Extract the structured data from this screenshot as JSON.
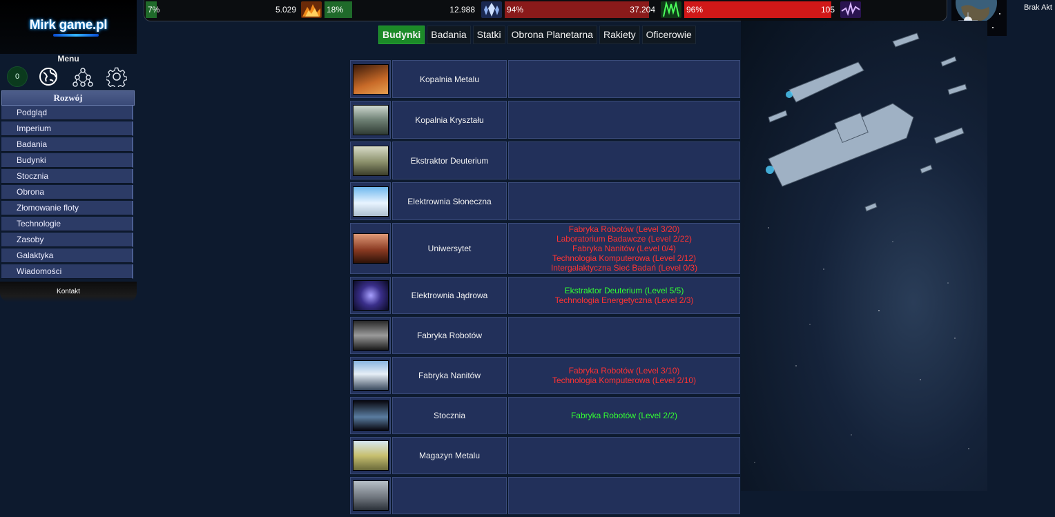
{
  "logo": {
    "text": "Mirk game.pl"
  },
  "menu": {
    "title": "Menu",
    "message_count": "0"
  },
  "menu_icons": [
    "globe-icon",
    "hierarchy-icon",
    "gear-icon"
  ],
  "sidebar": {
    "section_title": "Rozwój",
    "items": [
      {
        "label": "Podgląd"
      },
      {
        "label": "Imperium"
      },
      {
        "label": "Badania"
      },
      {
        "label": "Budynki"
      },
      {
        "label": "Stocznia"
      },
      {
        "label": "Obrona"
      },
      {
        "label": "Złomowanie floty"
      },
      {
        "label": "Technologie"
      },
      {
        "label": "Zasoby"
      },
      {
        "label": "Galaktyka"
      },
      {
        "label": "Wiadomości"
      }
    ],
    "kontakt": "Kontakt"
  },
  "resources": [
    {
      "name": "metal",
      "percent": "7%",
      "amount": "5.029",
      "fill": 0.07,
      "fill_color": "#1f6a2a",
      "icon": "metal-icon"
    },
    {
      "name": "crystal",
      "percent": "18%",
      "amount": "12.988",
      "fill": 0.18,
      "fill_color": "#1f6a2a",
      "icon": "crystal-icon"
    },
    {
      "name": "deuterium",
      "percent": "94%",
      "amount": "37.204",
      "fill": 0.94,
      "fill_color": "#8a1a1a",
      "icon": "deuterium-icon"
    },
    {
      "name": "energy",
      "percent": "96%",
      "amount": "105",
      "fill": 0.96,
      "fill_color": "#d01818",
      "icon": "energy-icon"
    }
  ],
  "top_right": {
    "status": "Brak Akt"
  },
  "tabs": [
    {
      "label": "Budynki",
      "active": true
    },
    {
      "label": "Badania",
      "active": false
    },
    {
      "label": "Statki",
      "active": false
    },
    {
      "label": "Obrona Planetarna",
      "active": false
    },
    {
      "label": "Rakiety",
      "active": false
    },
    {
      "label": "Oficerowie",
      "active": false
    }
  ],
  "buildings": [
    {
      "name": "Kopalnia Metalu",
      "requirements": []
    },
    {
      "name": "Kopalnia Kryształu",
      "requirements": []
    },
    {
      "name": "Ekstraktor Deuterium",
      "requirements": []
    },
    {
      "name": "Elektrownia Słoneczna",
      "requirements": []
    },
    {
      "name": "Uniwersytet",
      "requirements": [
        {
          "text": "Fabryka Robotów (Level 3/20)",
          "met": false
        },
        {
          "text": "Laboratorium Badawcze (Level 2/22)",
          "met": false
        },
        {
          "text": "Fabryka Nanitów (Level 0/4)",
          "met": false
        },
        {
          "text": "Technologia Komputerowa (Level 2/12)",
          "met": false
        },
        {
          "text": "Intergalaktyczna Sieć Badań (Level 0/3)",
          "met": false
        }
      ]
    },
    {
      "name": "Elektrownia Jądrowa",
      "requirements": [
        {
          "text": "Ekstraktor Deuterium (Level 5/5)",
          "met": true
        },
        {
          "text": "Technologia Energetyczna (Level 2/3)",
          "met": false
        }
      ]
    },
    {
      "name": "Fabryka Robotów",
      "requirements": []
    },
    {
      "name": "Fabryka Nanitów",
      "requirements": [
        {
          "text": "Fabryka Robotów (Level 3/10)",
          "met": false
        },
        {
          "text": "Technologia Komputerowa (Level 2/10)",
          "met": false
        }
      ]
    },
    {
      "name": "Stocznia",
      "requirements": [
        {
          "text": "Fabryka Robotów (Level 2/2)",
          "met": true
        }
      ]
    },
    {
      "name": "Magazyn Metalu",
      "requirements": []
    },
    {
      "name": "",
      "requirements": []
    }
  ],
  "colors": {
    "requirement_met": "#33ff33",
    "requirement_unmet": "#ff3333",
    "active_tab": "#1c8a28"
  }
}
